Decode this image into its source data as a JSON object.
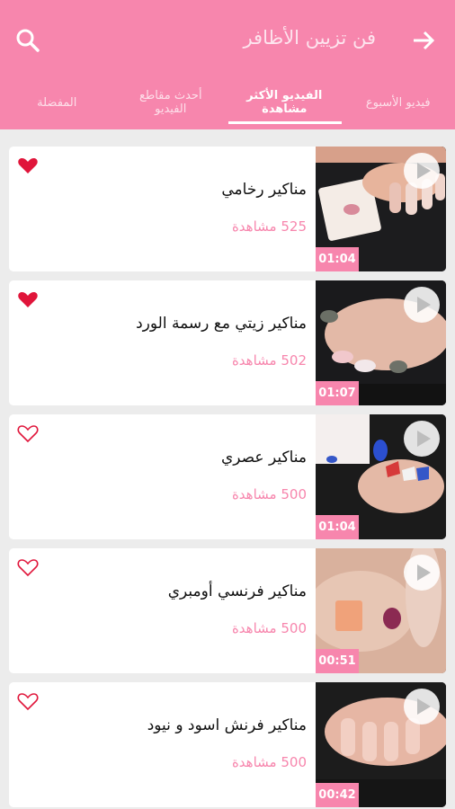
{
  "header": {
    "title": "فن تزيين الأظافر",
    "back_icon": "arrow-right-icon",
    "search_icon": "search-icon",
    "bg_color": "#f786ad"
  },
  "tabs": [
    {
      "label": "فيديو الأسبوع",
      "active": false
    },
    {
      "label": "الفيديو الأكثر\nمشاهدة",
      "active": true
    },
    {
      "label": "أحدث مقاطع\nالفيديو",
      "active": false
    },
    {
      "label": "المفضلة",
      "active": false
    }
  ],
  "videos": [
    {
      "title": "مناكير رخامي",
      "views": "525 مشاهدة",
      "duration": "01:04",
      "favorite": true
    },
    {
      "title": "مناكير زيتي مع رسمة الورد",
      "views": "502 مشاهدة",
      "duration": "01:07",
      "favorite": true
    },
    {
      "title": "مناكير عصري",
      "views": "500 مشاهدة",
      "duration": "01:04",
      "favorite": false
    },
    {
      "title": "مناكير فرنسي أومبري",
      "views": "500 مشاهدة",
      "duration": "00:51",
      "favorite": false
    },
    {
      "title": "مناكير فرنش اسود و نيود",
      "views": "500 مشاهدة",
      "duration": "00:42",
      "favorite": false
    }
  ],
  "colors": {
    "accent": "#f786ad",
    "favorite": "#e0153a"
  }
}
